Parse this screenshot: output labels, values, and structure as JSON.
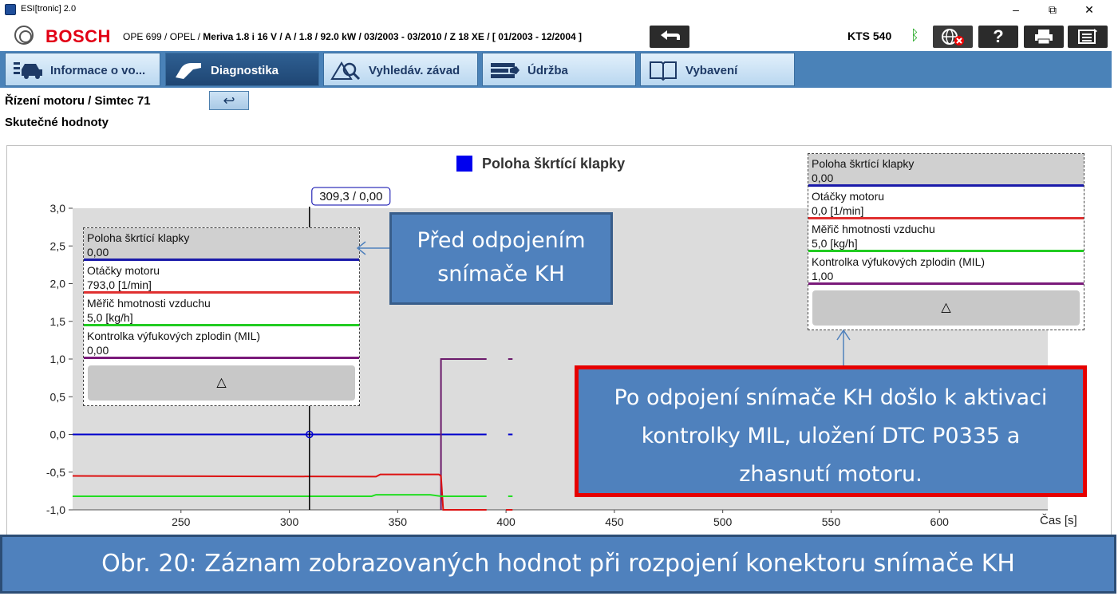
{
  "window": {
    "title": "ESI[tronic] 2.0",
    "controls": [
      "–",
      "⧉",
      "✕"
    ]
  },
  "header": {
    "brand": "BOSCH",
    "vehicle_prefix": "OPE 699 / OPEL / ",
    "vehicle_bold": "Meriva 1.8 i 16 V / A / 1.8 / 92.0 kW / 03/2003 - 03/2010 / Z 18 XE / [ 01/2003 - 12/2004 ]",
    "device": "KTS 540",
    "bluetooth_icon": "ᛒ",
    "icons": [
      "back-arrow-icon",
      "globe-offline-icon",
      "help-icon",
      "print-icon",
      "menu-icon"
    ]
  },
  "tabs": [
    {
      "label": "Informace o vo...",
      "icon": "vehicle-icon",
      "active": false
    },
    {
      "label": "Diagnostika",
      "icon": "diagnostics-icon",
      "active": true
    },
    {
      "label": "Vyhledáv. závad",
      "icon": "troubleshoot-icon",
      "active": false
    },
    {
      "label": "Údržba",
      "icon": "maintenance-icon",
      "active": false
    },
    {
      "label": "Vybavení",
      "icon": "equipment-book-icon",
      "active": false
    }
  ],
  "breadcrumb": "Řízení motoru / Simtec 71",
  "subtitle": "Skutečné hodnoty",
  "cursor_readout": "309,3 / 0,00",
  "legend_left": [
    {
      "name": "Poloha škrtící klapky",
      "value": "0,00",
      "color": "#1a1aaa"
    },
    {
      "name": "Otáčky motoru",
      "value": "793,0 [1/min]",
      "color": "#e03030"
    },
    {
      "name": "Měřič hmotnosti vzduchu",
      "value": "5,0 [kg/h]",
      "color": "#22cc22"
    },
    {
      "name": "Kontrolka výfukových zplodin (MIL)",
      "value": "0,00",
      "color": "#7a1a7a"
    }
  ],
  "legend_right": [
    {
      "name": "Poloha škrtící klapky",
      "value": "0,00",
      "color": "#1a1aaa"
    },
    {
      "name": "Otáčky motoru",
      "value": "0,0 [1/min]",
      "color": "#e03030"
    },
    {
      "name": "Měřič hmotnosti vzduchu",
      "value": "5,0 [kg/h]",
      "color": "#22cc22"
    },
    {
      "name": "Kontrolka výfukových zplodin (MIL)",
      "value": "1,00",
      "color": "#7a1a7a"
    }
  ],
  "legend_collapse_glyph": "△",
  "callout_before_lines": [
    "Před odpojením",
    "snímače KH"
  ],
  "callout_after_lines": [
    "Po odpojení snímače KH došlo k aktivaci",
    "kontrolky MIL, uložení DTC P0335 a",
    "zhasnutí motoru."
  ],
  "caption": "Obr. 20: Záznam zobrazovaných hodnot při rozpojení konektoru snímače KH",
  "chart_data": {
    "type": "line",
    "title": "Poloha škrtící klapky",
    "xlabel": "Čas [s]",
    "ylabel": "",
    "xlim": [
      200,
      650
    ],
    "ylim": [
      -1.0,
      3.0
    ],
    "x_ticks": [
      "250",
      "300",
      "350",
      "400",
      "450",
      "500",
      "550",
      "600"
    ],
    "y_ticks": [
      "3,0",
      "2,5",
      "2,0",
      "1,5",
      "1,0",
      "0,5",
      "0,0",
      "-0,5",
      "-1,0"
    ],
    "cursor_x": 309.3,
    "series": [
      {
        "name": "Poloha škrtící klapky",
        "color": "#0000cc",
        "segments": [
          [
            [
              200,
              0.0
            ],
            [
              391,
              0.0
            ]
          ],
          [
            [
              401,
              0.0
            ],
            [
              403,
              0.0
            ]
          ]
        ]
      },
      {
        "name": "Kontrolka výfukových zplodin (MIL)",
        "color": "#6b1a6b",
        "segments": [
          [
            [
              370,
              -1.0
            ],
            [
              370,
              1.0
            ],
            [
              391,
              1.0
            ]
          ],
          [
            [
              401,
              1.0
            ],
            [
              403,
              1.0
            ]
          ]
        ]
      },
      {
        "name": "Otáčky motoru",
        "color": "#dd1111",
        "segments": [
          [
            [
              200,
              -0.55
            ],
            [
              340,
              -0.56
            ],
            [
              342,
              -0.53
            ],
            [
              369,
              -0.53
            ],
            [
              370,
              -0.55
            ],
            [
              371,
              -1.0
            ],
            [
              391,
              -1.0
            ]
          ],
          [
            [
              400,
              -1.0
            ],
            [
              403,
              -1.0
            ]
          ]
        ]
      },
      {
        "name": "Měřič hmotnosti vzduchu",
        "color": "#22dd22",
        "segments": [
          [
            [
              200,
              -0.82
            ],
            [
              338,
              -0.82
            ],
            [
              340,
              -0.8
            ],
            [
              365,
              -0.8
            ],
            [
              370,
              -0.82
            ],
            [
              391,
              -0.82
            ]
          ],
          [
            [
              401,
              -0.82
            ],
            [
              403,
              -0.82
            ]
          ]
        ]
      }
    ]
  }
}
